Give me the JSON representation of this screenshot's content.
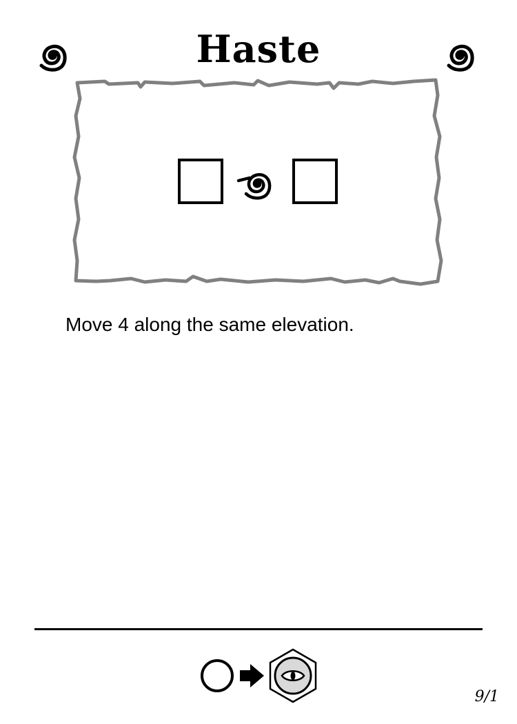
{
  "card": {
    "title": "Haste",
    "ability_text": "Move 4 along the same elevation.",
    "card_number": "9/1"
  },
  "icons": {
    "title_left": "swirl-icon",
    "title_right": "swirl-icon",
    "cost_center": "swirl-icon",
    "footer": [
      "empty-circle-icon",
      "right-arrow-icon",
      "hexagon-eye-icon"
    ]
  },
  "colors": {
    "ink": "#000000",
    "parchment_border": "#808080",
    "hex_fill": "#d9d9d9",
    "background": "#ffffff"
  }
}
